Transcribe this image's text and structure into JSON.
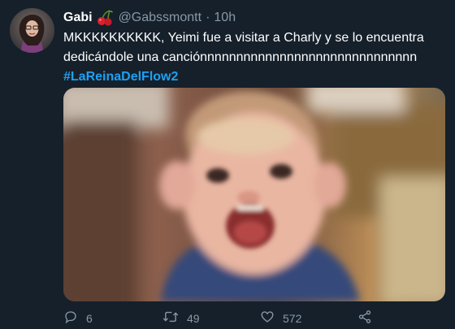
{
  "tweet": {
    "author_name": "Gabi",
    "author_emoji": "cherries-emoji",
    "handle": "@Gabssmontt",
    "separator": "·",
    "time": "10h",
    "text_line1": "MKKKKKKKKKK, Yeimi fue a visitar a Charly y se lo encuentra",
    "text_line2": "dedicándole una canciónnnnnnnnnnnnnnnnnnnnnnnnnnnnnn",
    "hashtag": "#LaReinaDelFlow2",
    "media": "screaming-child-photo"
  },
  "actions": {
    "reply_count": "6",
    "retweet_count": "49",
    "like_count": "572"
  },
  "colors": {
    "background": "#15202b",
    "secondary_text": "#8899a6",
    "hashtag": "#1da1f2"
  },
  "icons": [
    "reply-icon",
    "retweet-icon",
    "like-icon",
    "share-icon"
  ]
}
